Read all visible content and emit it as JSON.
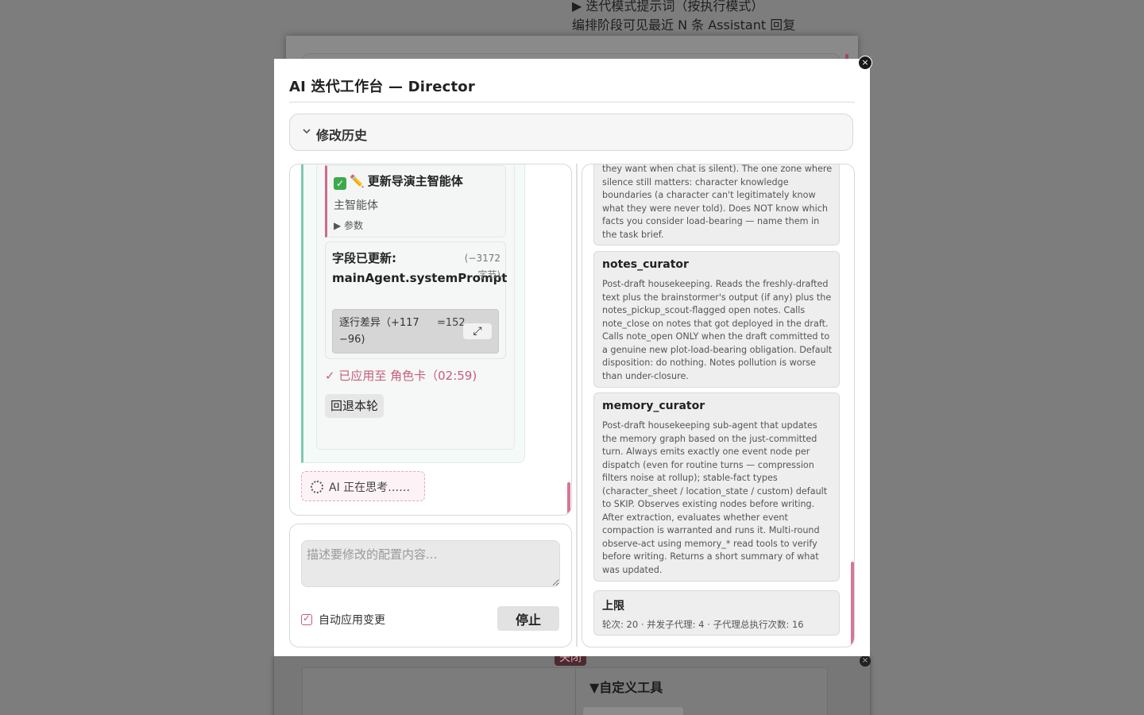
{
  "background": {
    "top_line_1": "▶ 迭代模式提示词（按执行模式）",
    "top_line_2": "编排阶段可见最近 N 条 Assistant 回复",
    "close_badge": "关闭",
    "close_icon": "×",
    "custom_tools_title": "▼自定义工具"
  },
  "modal": {
    "title": "AI 迭代工作台 — Director",
    "close_icon": "×"
  },
  "history": {
    "label": "修改历史"
  },
  "chat": {
    "tool_call": {
      "title": "更新导演主智能体",
      "subtitle": "主智能体",
      "params_toggle": "▶ 参数"
    },
    "field_update": {
      "title": "字段已更新: mainAgent.systemPrompt",
      "delta": "(−3172 字节)",
      "diff_label": "逐行差异（+117 −96)",
      "diff_equal": "=152",
      "expand_icon": "⤢"
    },
    "applied": "✓ 已应用至 角色卡（02:59)",
    "rollback_label": "回退本轮",
    "thinking": "AI 正在思考……"
  },
  "input": {
    "placeholder": "描述要修改的配置内容...",
    "auto_apply_label": "自动应用变更",
    "auto_apply_checked": true,
    "stop_label": "停止"
  },
  "agents": {
    "partial_desc": "they want when chat is silent). The one zone where silence still matters: character knowledge boundaries (a character can't legitimately know what they were never told). Does NOT know which facts you consider load-bearing — name them in the task brief.",
    "items": [
      {
        "name": "notes_curator",
        "desc": "Post-draft housekeeping. Reads the freshly-drafted text plus the brainstormer's output (if any) plus the notes_pickup_scout-flagged open notes. Calls note_close on notes that got deployed in the draft. Calls note_open ONLY when the draft committed to a genuine new plot-load-bearing obligation. Default disposition: do nothing. Notes pollution is worse than under-closure."
      },
      {
        "name": "memory_curator",
        "desc": "Post-draft housekeeping sub-agent that updates the memory graph based on the just-committed turn. Always emits exactly one event node per dispatch (even for routine turns — compression filters noise at rollup); stable-fact types (character_sheet / location_state / custom) default to SKIP. Observes existing nodes before writing. After extraction, evaluates whether event compaction is warranted and runs it. Multi-round observe-act using memory_* read tools to verify before writing. Returns a short summary of what was updated."
      }
    ],
    "limits": {
      "title": "上限",
      "text": "轮次: 20 · 并发子代理: 4 · 子代理总执行次数: 16"
    }
  }
}
